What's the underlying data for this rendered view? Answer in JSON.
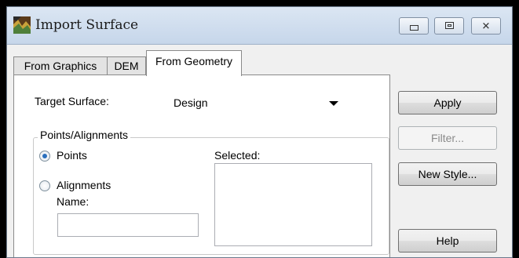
{
  "window": {
    "title": "Import Surface"
  },
  "tabs": [
    {
      "label": "From Graphics"
    },
    {
      "label": "DEM"
    },
    {
      "label": "From Geometry"
    }
  ],
  "form": {
    "target_surface_label": "Target Surface:",
    "target_surface_value": "Design",
    "group_label": "Points/Alignments",
    "points_label": "Points",
    "alignments_label": "Alignments",
    "name_label": "Name:",
    "name_value": "",
    "selected_label": "Selected:",
    "selected_mode": "Points"
  },
  "buttons": {
    "apply": "Apply",
    "filter": "Filter...",
    "new_style": "New Style...",
    "help": "Help"
  }
}
